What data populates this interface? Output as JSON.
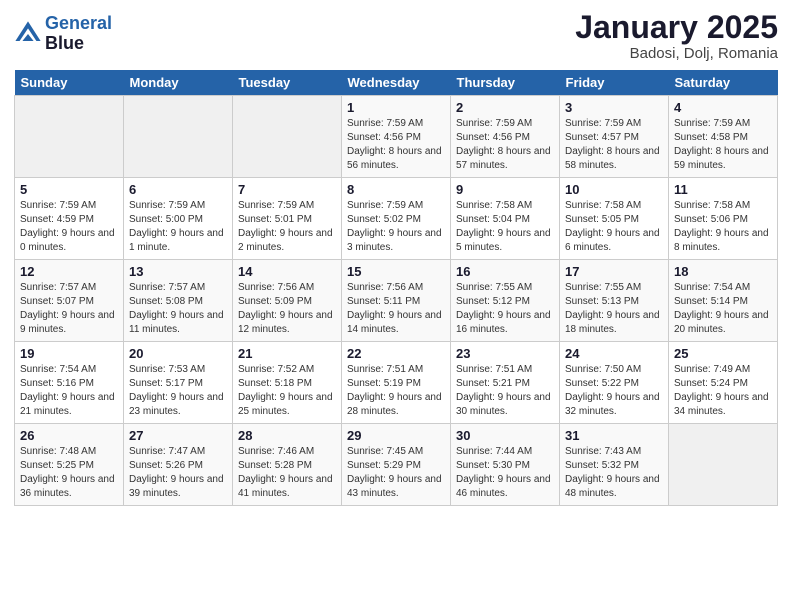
{
  "header": {
    "logo_line1": "General",
    "logo_line2": "Blue",
    "month": "January 2025",
    "location": "Badosi, Dolj, Romania"
  },
  "days_of_week": [
    "Sunday",
    "Monday",
    "Tuesday",
    "Wednesday",
    "Thursday",
    "Friday",
    "Saturday"
  ],
  "weeks": [
    [
      {
        "day": "",
        "sunrise": "",
        "sunset": "",
        "daylight": ""
      },
      {
        "day": "",
        "sunrise": "",
        "sunset": "",
        "daylight": ""
      },
      {
        "day": "",
        "sunrise": "",
        "sunset": "",
        "daylight": ""
      },
      {
        "day": "1",
        "sunrise": "Sunrise: 7:59 AM",
        "sunset": "Sunset: 4:56 PM",
        "daylight": "Daylight: 8 hours and 56 minutes."
      },
      {
        "day": "2",
        "sunrise": "Sunrise: 7:59 AM",
        "sunset": "Sunset: 4:56 PM",
        "daylight": "Daylight: 8 hours and 57 minutes."
      },
      {
        "day": "3",
        "sunrise": "Sunrise: 7:59 AM",
        "sunset": "Sunset: 4:57 PM",
        "daylight": "Daylight: 8 hours and 58 minutes."
      },
      {
        "day": "4",
        "sunrise": "Sunrise: 7:59 AM",
        "sunset": "Sunset: 4:58 PM",
        "daylight": "Daylight: 8 hours and 59 minutes."
      }
    ],
    [
      {
        "day": "5",
        "sunrise": "Sunrise: 7:59 AM",
        "sunset": "Sunset: 4:59 PM",
        "daylight": "Daylight: 9 hours and 0 minutes."
      },
      {
        "day": "6",
        "sunrise": "Sunrise: 7:59 AM",
        "sunset": "Sunset: 5:00 PM",
        "daylight": "Daylight: 9 hours and 1 minute."
      },
      {
        "day": "7",
        "sunrise": "Sunrise: 7:59 AM",
        "sunset": "Sunset: 5:01 PM",
        "daylight": "Daylight: 9 hours and 2 minutes."
      },
      {
        "day": "8",
        "sunrise": "Sunrise: 7:59 AM",
        "sunset": "Sunset: 5:02 PM",
        "daylight": "Daylight: 9 hours and 3 minutes."
      },
      {
        "day": "9",
        "sunrise": "Sunrise: 7:58 AM",
        "sunset": "Sunset: 5:04 PM",
        "daylight": "Daylight: 9 hours and 5 minutes."
      },
      {
        "day": "10",
        "sunrise": "Sunrise: 7:58 AM",
        "sunset": "Sunset: 5:05 PM",
        "daylight": "Daylight: 9 hours and 6 minutes."
      },
      {
        "day": "11",
        "sunrise": "Sunrise: 7:58 AM",
        "sunset": "Sunset: 5:06 PM",
        "daylight": "Daylight: 9 hours and 8 minutes."
      }
    ],
    [
      {
        "day": "12",
        "sunrise": "Sunrise: 7:57 AM",
        "sunset": "Sunset: 5:07 PM",
        "daylight": "Daylight: 9 hours and 9 minutes."
      },
      {
        "day": "13",
        "sunrise": "Sunrise: 7:57 AM",
        "sunset": "Sunset: 5:08 PM",
        "daylight": "Daylight: 9 hours and 11 minutes."
      },
      {
        "day": "14",
        "sunrise": "Sunrise: 7:56 AM",
        "sunset": "Sunset: 5:09 PM",
        "daylight": "Daylight: 9 hours and 12 minutes."
      },
      {
        "day": "15",
        "sunrise": "Sunrise: 7:56 AM",
        "sunset": "Sunset: 5:11 PM",
        "daylight": "Daylight: 9 hours and 14 minutes."
      },
      {
        "day": "16",
        "sunrise": "Sunrise: 7:55 AM",
        "sunset": "Sunset: 5:12 PM",
        "daylight": "Daylight: 9 hours and 16 minutes."
      },
      {
        "day": "17",
        "sunrise": "Sunrise: 7:55 AM",
        "sunset": "Sunset: 5:13 PM",
        "daylight": "Daylight: 9 hours and 18 minutes."
      },
      {
        "day": "18",
        "sunrise": "Sunrise: 7:54 AM",
        "sunset": "Sunset: 5:14 PM",
        "daylight": "Daylight: 9 hours and 20 minutes."
      }
    ],
    [
      {
        "day": "19",
        "sunrise": "Sunrise: 7:54 AM",
        "sunset": "Sunset: 5:16 PM",
        "daylight": "Daylight: 9 hours and 21 minutes."
      },
      {
        "day": "20",
        "sunrise": "Sunrise: 7:53 AM",
        "sunset": "Sunset: 5:17 PM",
        "daylight": "Daylight: 9 hours and 23 minutes."
      },
      {
        "day": "21",
        "sunrise": "Sunrise: 7:52 AM",
        "sunset": "Sunset: 5:18 PM",
        "daylight": "Daylight: 9 hours and 25 minutes."
      },
      {
        "day": "22",
        "sunrise": "Sunrise: 7:51 AM",
        "sunset": "Sunset: 5:19 PM",
        "daylight": "Daylight: 9 hours and 28 minutes."
      },
      {
        "day": "23",
        "sunrise": "Sunrise: 7:51 AM",
        "sunset": "Sunset: 5:21 PM",
        "daylight": "Daylight: 9 hours and 30 minutes."
      },
      {
        "day": "24",
        "sunrise": "Sunrise: 7:50 AM",
        "sunset": "Sunset: 5:22 PM",
        "daylight": "Daylight: 9 hours and 32 minutes."
      },
      {
        "day": "25",
        "sunrise": "Sunrise: 7:49 AM",
        "sunset": "Sunset: 5:24 PM",
        "daylight": "Daylight: 9 hours and 34 minutes."
      }
    ],
    [
      {
        "day": "26",
        "sunrise": "Sunrise: 7:48 AM",
        "sunset": "Sunset: 5:25 PM",
        "daylight": "Daylight: 9 hours and 36 minutes."
      },
      {
        "day": "27",
        "sunrise": "Sunrise: 7:47 AM",
        "sunset": "Sunset: 5:26 PM",
        "daylight": "Daylight: 9 hours and 39 minutes."
      },
      {
        "day": "28",
        "sunrise": "Sunrise: 7:46 AM",
        "sunset": "Sunset: 5:28 PM",
        "daylight": "Daylight: 9 hours and 41 minutes."
      },
      {
        "day": "29",
        "sunrise": "Sunrise: 7:45 AM",
        "sunset": "Sunset: 5:29 PM",
        "daylight": "Daylight: 9 hours and 43 minutes."
      },
      {
        "day": "30",
        "sunrise": "Sunrise: 7:44 AM",
        "sunset": "Sunset: 5:30 PM",
        "daylight": "Daylight: 9 hours and 46 minutes."
      },
      {
        "day": "31",
        "sunrise": "Sunrise: 7:43 AM",
        "sunset": "Sunset: 5:32 PM",
        "daylight": "Daylight: 9 hours and 48 minutes."
      },
      {
        "day": "",
        "sunrise": "",
        "sunset": "",
        "daylight": ""
      }
    ]
  ]
}
